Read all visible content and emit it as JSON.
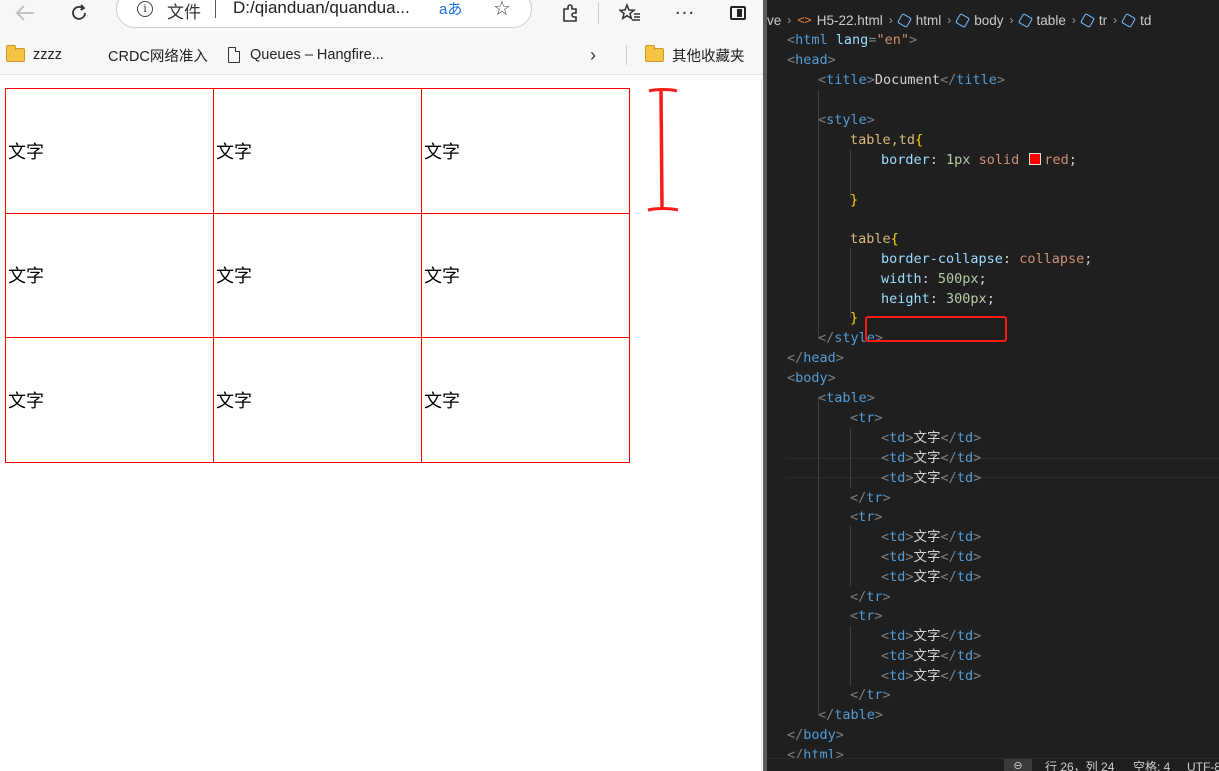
{
  "browser": {
    "address": {
      "scheme_label": "文件",
      "url": "D:/qianduan/quandua...",
      "read_aloud_label": "aあ"
    },
    "bookmarks": [
      "zzzz",
      "CRDC网络准入",
      "Queues – Hangfire...",
      "其他收藏夹"
    ],
    "table": {
      "rows": [
        [
          "文字",
          "文字",
          "文字"
        ],
        [
          "文字",
          "文字",
          "文字"
        ],
        [
          "文字",
          "文字",
          "文字"
        ]
      ]
    }
  },
  "editor": {
    "breadcrumb": [
      "ve",
      "H5-22.html",
      "html",
      "body",
      "table",
      "tr",
      "td"
    ],
    "code": {
      "html_open_tag": "html",
      "lang_attr": "lang",
      "lang_value": "\"en\"",
      "head_tag": "head",
      "title_tag": "title",
      "title_text": "Document",
      "style_tag": "style",
      "selector1": "table,td",
      "border_prop": "border",
      "border_width": "1px",
      "border_style": "solid",
      "border_color": "red",
      "selector2": "table",
      "collapse_prop": "border-collapse",
      "collapse_value": "collapse",
      "width_prop": "width",
      "width_value": "500px",
      "height_prop": "height",
      "height_value": "300px",
      "body_tag": "body",
      "table_tag": "table",
      "tr_tag": "tr",
      "td_tag": "td",
      "cell_text": "文字"
    },
    "status": {
      "position": "行 26，列 24",
      "spaces": "空格: 4",
      "encoding": "UTF-8"
    }
  },
  "colors": {
    "table_border": "#ff0000",
    "annotation": "#ff1a1a",
    "editor_bg": "#1f1f1f"
  }
}
